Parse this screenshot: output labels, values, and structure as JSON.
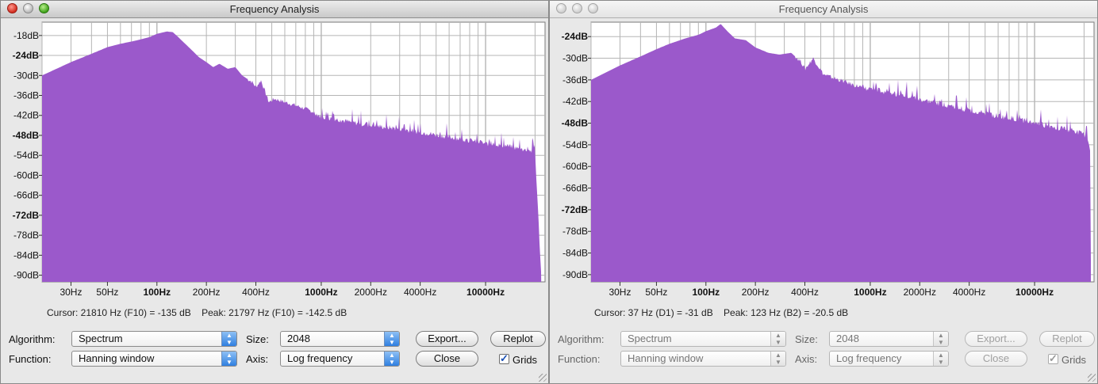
{
  "colors": {
    "spectrum_fill": "#9b59cb",
    "grid": "#b5b5b5",
    "plot_bg": "#ffffff"
  },
  "freq_ticks": [
    {
      "label": "30Hz",
      "hz": 30,
      "bold": false
    },
    {
      "label": "50Hz",
      "hz": 50,
      "bold": false
    },
    {
      "label": "100Hz",
      "hz": 100,
      "bold": true
    },
    {
      "label": "200Hz",
      "hz": 200,
      "bold": false
    },
    {
      "label": "400Hz",
      "hz": 400,
      "bold": false
    },
    {
      "label": "1000Hz",
      "hz": 1000,
      "bold": true
    },
    {
      "label": "2000Hz",
      "hz": 2000,
      "bold": false
    },
    {
      "label": "4000Hz",
      "hz": 4000,
      "bold": false
    },
    {
      "label": "10000Hz",
      "hz": 10000,
      "bold": true
    }
  ],
  "windows": [
    {
      "title": "Frequency Analysis",
      "active": true,
      "cursor_text": "Cursor: 21810 Hz (F10) = -135 dB    Peak: 21797 Hz (F10) = -142.5 dB",
      "chart_data": {
        "type": "area",
        "x_scale": "log",
        "xlim_hz": [
          20,
          23000
        ],
        "ylim_db": [
          -92,
          -14
        ],
        "grid": true,
        "y_ticks": [
          {
            "label": "-18dB",
            "value": -18,
            "bold": false
          },
          {
            "label": "-24dB",
            "value": -24,
            "bold": true
          },
          {
            "label": "-30dB",
            "value": -30,
            "bold": false
          },
          {
            "label": "-36dB",
            "value": -36,
            "bold": false
          },
          {
            "label": "-42dB",
            "value": -42,
            "bold": false
          },
          {
            "label": "-48dB",
            "value": -48,
            "bold": true
          },
          {
            "label": "-54dB",
            "value": -54,
            "bold": false
          },
          {
            "label": "-60dB",
            "value": -60,
            "bold": false
          },
          {
            "label": "-66dB",
            "value": -66,
            "bold": false
          },
          {
            "label": "-72dB",
            "value": -72,
            "bold": true
          },
          {
            "label": "-78dB",
            "value": -78,
            "bold": false
          },
          {
            "label": "-84dB",
            "value": -84,
            "bold": false
          },
          {
            "label": "-90dB",
            "value": -90,
            "bold": false
          }
        ],
        "series": [
          {
            "points": [
              [
                20,
                -30
              ],
              [
                30,
                -26
              ],
              [
                40,
                -23.5
              ],
              [
                50,
                -21.5
              ],
              [
                60,
                -20.5
              ],
              [
                75,
                -19.5
              ],
              [
                90,
                -18.5
              ],
              [
                100,
                -17.5
              ],
              [
                115,
                -16.8
              ],
              [
                125,
                -17
              ],
              [
                135,
                -18.5
              ],
              [
                145,
                -20
              ],
              [
                160,
                -22
              ],
              [
                180,
                -24.5
              ],
              [
                200,
                -26
              ],
              [
                220,
                -27.5
              ],
              [
                240,
                -26.5
              ],
              [
                270,
                -28
              ],
              [
                300,
                -27.5
              ],
              [
                330,
                -30
              ],
              [
                380,
                -32
              ],
              [
                400,
                -33.5
              ],
              [
                430,
                -31.5
              ],
              [
                480,
                -38
              ],
              [
                520,
                -37
              ],
              [
                600,
                -38
              ],
              [
                700,
                -39
              ],
              [
                800,
                -40
              ],
              [
                900,
                -41
              ],
              [
                1000,
                -42.5
              ],
              [
                1200,
                -43
              ],
              [
                1500,
                -44
              ],
              [
                2000,
                -45
              ],
              [
                3000,
                -46
              ],
              [
                4000,
                -47
              ],
              [
                6000,
                -48.5
              ],
              [
                8000,
                -49.5
              ],
              [
                10000,
                -50.5
              ],
              [
                13000,
                -51
              ],
              [
                16000,
                -52
              ],
              [
                20000,
                -53
              ],
              [
                21800,
                -90
              ]
            ]
          }
        ]
      },
      "controls": {
        "algorithm_label": "Algorithm:",
        "algorithm_value": "Spectrum",
        "function_label": "Function:",
        "function_value": "Hanning window",
        "size_label": "Size:",
        "size_value": "2048",
        "axis_label": "Axis:",
        "axis_value": "Log frequency",
        "export_label": "Export...",
        "replot_label": "Replot",
        "close_label": "Close",
        "grids_label": "Grids",
        "grids_checked": true
      }
    },
    {
      "title": "Frequency Analysis",
      "active": false,
      "cursor_text": "Cursor: 37 Hz (D1) = -31 dB    Peak: 123 Hz (B2) = -20.5 dB",
      "chart_data": {
        "type": "area",
        "x_scale": "log",
        "xlim_hz": [
          20,
          23000
        ],
        "ylim_db": [
          -92,
          -20
        ],
        "grid": true,
        "y_ticks": [
          {
            "label": "-24dB",
            "value": -24,
            "bold": true
          },
          {
            "label": "-30dB",
            "value": -30,
            "bold": false
          },
          {
            "label": "-36dB",
            "value": -36,
            "bold": false
          },
          {
            "label": "-42dB",
            "value": -42,
            "bold": false
          },
          {
            "label": "-48dB",
            "value": -48,
            "bold": true
          },
          {
            "label": "-54dB",
            "value": -54,
            "bold": false
          },
          {
            "label": "-60dB",
            "value": -60,
            "bold": false
          },
          {
            "label": "-66dB",
            "value": -66,
            "bold": false
          },
          {
            "label": "-72dB",
            "value": -72,
            "bold": true
          },
          {
            "label": "-78dB",
            "value": -78,
            "bold": false
          },
          {
            "label": "-84dB",
            "value": -84,
            "bold": false
          },
          {
            "label": "-90dB",
            "value": -90,
            "bold": false
          }
        ],
        "series": [
          {
            "points": [
              [
                20,
                -36
              ],
              [
                30,
                -32
              ],
              [
                40,
                -29.5
              ],
              [
                50,
                -27.5
              ],
              [
                60,
                -26
              ],
              [
                75,
                -24.5
              ],
              [
                90,
                -23.5
              ],
              [
                100,
                -22.5
              ],
              [
                115,
                -21.5
              ],
              [
                123,
                -20.5
              ],
              [
                135,
                -22.5
              ],
              [
                150,
                -24.5
              ],
              [
                175,
                -25
              ],
              [
                200,
                -27
              ],
              [
                240,
                -28.5
              ],
              [
                280,
                -29
              ],
              [
                330,
                -28.5
              ],
              [
                380,
                -31
              ],
              [
                400,
                -33
              ],
              [
                450,
                -30
              ],
              [
                520,
                -34.5
              ],
              [
                600,
                -35.5
              ],
              [
                700,
                -36.5
              ],
              [
                800,
                -37.5
              ],
              [
                1000,
                -38.5
              ],
              [
                1500,
                -40
              ],
              [
                2000,
                -41.5
              ],
              [
                3000,
                -43
              ],
              [
                4000,
                -44.5
              ],
              [
                6000,
                -46
              ],
              [
                8000,
                -47
              ],
              [
                10000,
                -48
              ],
              [
                15000,
                -49.5
              ],
              [
                20000,
                -51
              ],
              [
                21800,
                -55
              ],
              [
                22000,
                -90
              ]
            ]
          }
        ]
      },
      "controls": {
        "algorithm_label": "Algorithm:",
        "algorithm_value": "Spectrum",
        "function_label": "Function:",
        "function_value": "Hanning window",
        "size_label": "Size:",
        "size_value": "2048",
        "axis_label": "Axis:",
        "axis_value": "Log frequency",
        "export_label": "Export...",
        "replot_label": "Replot",
        "close_label": "Close",
        "grids_label": "Grids",
        "grids_checked": true
      }
    }
  ]
}
